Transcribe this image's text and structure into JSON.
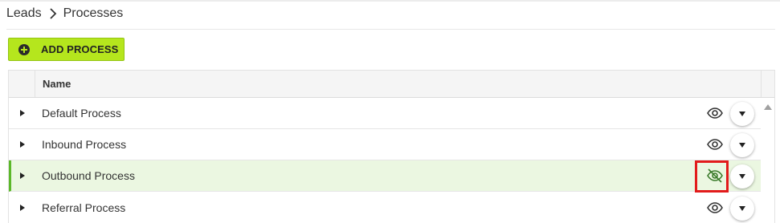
{
  "breadcrumb": {
    "items": [
      "Leads",
      "Processes"
    ]
  },
  "toolbar": {
    "add_label": "ADD PROCESS"
  },
  "grid": {
    "columns": [
      "Name"
    ],
    "rows": [
      {
        "name": "Default Process",
        "visibility": "visible",
        "selected": false
      },
      {
        "name": "Inbound Process",
        "visibility": "visible",
        "selected": false
      },
      {
        "name": "Outbound Process",
        "visibility": "hidden",
        "selected": true
      },
      {
        "name": "Referral Process",
        "visibility": "visible",
        "selected": false
      }
    ]
  },
  "icons": {
    "add": "plus-circle-icon",
    "visible": "eye-icon",
    "hidden": "eye-off-icon",
    "menu": "chevron-down-icon",
    "expand": "caret-right-icon"
  },
  "colors": {
    "accent": "#b5e61d",
    "selected_row": "#ebf7e1",
    "selected_bar": "#5cb82a",
    "highlight": "#e21b1b"
  }
}
